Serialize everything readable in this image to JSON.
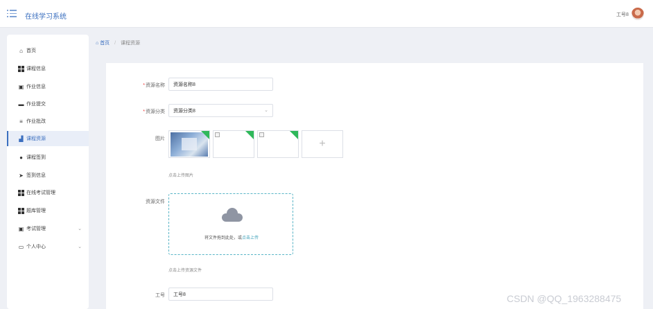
{
  "app": {
    "title": "在线学习系统",
    "user_name": "工号8"
  },
  "sidebar": {
    "items": [
      {
        "label": "首页",
        "icon": "home-icon"
      },
      {
        "label": "课程信息",
        "icon": "grid-icon"
      },
      {
        "label": "作业信息",
        "icon": "clipboard-icon"
      },
      {
        "label": "作业提交",
        "icon": "comment-icon"
      },
      {
        "label": "作业批改",
        "icon": "list-icon"
      },
      {
        "label": "课程资源",
        "icon": "chart-icon"
      },
      {
        "label": "课程签到",
        "icon": "user-icon"
      },
      {
        "label": "签到信息",
        "icon": "send-icon"
      },
      {
        "label": "在线考试管理",
        "icon": "grid-icon"
      },
      {
        "label": "题库管理",
        "icon": "grid-icon"
      },
      {
        "label": "考试管理",
        "icon": "clipboard-icon"
      },
      {
        "label": "个人中心",
        "icon": "window-icon"
      }
    ]
  },
  "breadcrumb": {
    "home": "首页",
    "separator": "/",
    "current": "课程资源"
  },
  "form": {
    "resource_name_label": "资源名称",
    "resource_name_value": "资源名称8",
    "resource_type_label": "资源分类",
    "resource_type_value": "资源分类8",
    "image_label": "图片",
    "image_hint": "点击上传图片",
    "file_label": "资源文件",
    "upload_text": "将文件拖到此处，或",
    "upload_link": "点击上传",
    "file_hint": "点击上传资源文件",
    "staff_no_label": "工号",
    "staff_no_value": "工号8"
  },
  "watermark": "CSDN @QQ_1963288475",
  "colors": {
    "accent": "#3b6fbf",
    "upload_border": "#57b4c6",
    "required": "#e33333"
  }
}
